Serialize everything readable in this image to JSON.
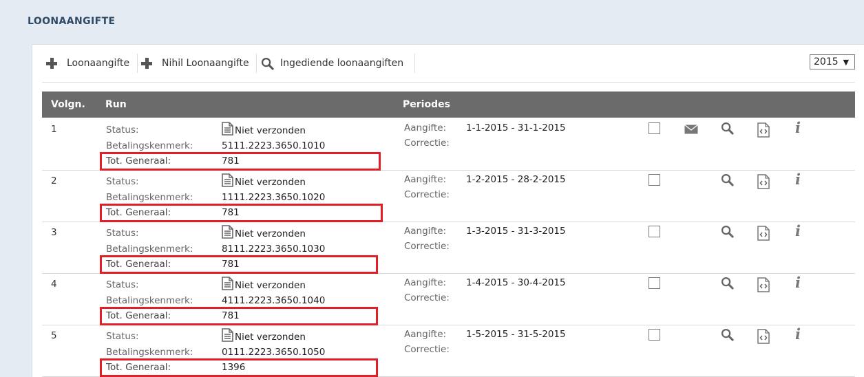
{
  "page": {
    "title": "LOONAANGIFTE"
  },
  "toolbar": {
    "add_label": "Loonaangifte",
    "nihil_label": "Nihil Loonaangifte",
    "submitted_label": "Ingediende loonaangiften",
    "year": "2015"
  },
  "table": {
    "headers": {
      "seq": "Volgn.",
      "run": "Run",
      "periods": "Periodes"
    },
    "labels": {
      "status": "Status:",
      "payment_ref": "Betalingskenmerk:",
      "total": "Tot. Generaal:",
      "aangifte": "Aangifte:",
      "correctie": "Correctie:"
    },
    "rows": [
      {
        "seq": "1",
        "status": "Niet verzonden",
        "payment_ref": "5111.2223.3650.1010",
        "total": "781",
        "aangifte_period": "1-1-2015 - 31-1-2015",
        "has_mail": true
      },
      {
        "seq": "2",
        "status": "Niet verzonden",
        "payment_ref": "1111.2223.3650.1020",
        "total": "781",
        "aangifte_period": "1-2-2015 - 28-2-2015",
        "has_mail": false
      },
      {
        "seq": "3",
        "status": "Niet verzonden",
        "payment_ref": "8111.2223.3650.1030",
        "total": "781",
        "aangifte_period": "1-3-2015 - 31-3-2015",
        "has_mail": false
      },
      {
        "seq": "4",
        "status": "Niet verzonden",
        "payment_ref": "4111.2223.3650.1040",
        "total": "781",
        "aangifte_period": "1-4-2015 - 30-4-2015",
        "has_mail": false
      },
      {
        "seq": "5",
        "status": "Niet verzonden",
        "payment_ref": "0111.2223.3650.1050",
        "total": "1396",
        "aangifte_period": "1-5-2015 - 31-5-2015",
        "has_mail": false
      }
    ]
  },
  "colors": {
    "header_bg": "#6b6b6b",
    "highlight": "#e21f26",
    "title": "#2e4a66",
    "background": "#e4ebf3"
  },
  "icons": [
    "plus-icon",
    "search-icon",
    "document-icon",
    "mail-icon",
    "code-file-icon",
    "info-icon",
    "checkbox"
  ]
}
